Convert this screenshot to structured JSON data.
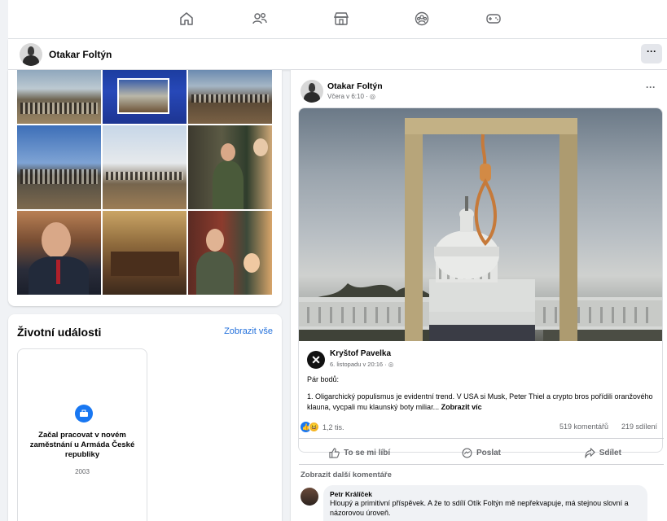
{
  "nav": {
    "icons": [
      "home-icon",
      "friends-icon",
      "marketplace-icon",
      "groups-icon",
      "gaming-icon"
    ]
  },
  "profile": {
    "name": "Otakar Foltýn",
    "more_label": "···"
  },
  "life_events": {
    "title": "Životní události",
    "see_all": "Zobrazit vše",
    "event_text": "Začal pracovat v novém zaměstnání u Armáda České republiky",
    "event_year": "2003"
  },
  "post": {
    "author": "Otakar Foltýn",
    "meta": "Včera v 6:10 · ",
    "more_label": "···",
    "shared": {
      "author": "Kryštof Pavelka",
      "meta": "6. listopadu v 20:16 · ",
      "lead": "Pár bodů:",
      "text": "1. Oligarchický populismus je evidentní trend. V USA si  Musk, Peter Thiel a crypto bros pořídili oranžového klauna, vycpali mu klaunský boty miliar...",
      "more": "Zobrazit víc"
    },
    "reactions_count": "1,2 tis.",
    "comments_count": "519 komentářů",
    "shares_count": "219 sdílení",
    "actions": {
      "like": "To se mi líbí",
      "send": "Poslat",
      "share": "Sdílet"
    },
    "more_comments": "Zobrazit další komentáře",
    "comment": {
      "author": "Petr Králíček",
      "text": "Hloupý a primitivní příspěvek. A že to sdílí Otík Foltýn mě nepřekvapuje, má stejnou slovní a názorovou úroveň."
    }
  }
}
